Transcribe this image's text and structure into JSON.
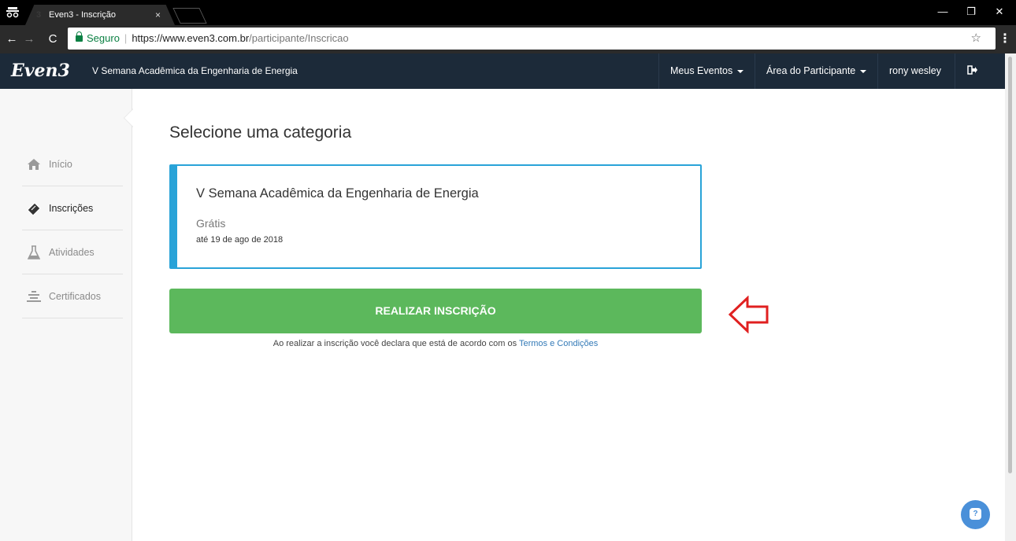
{
  "browser": {
    "tab_title": "Even3 - Inscrição",
    "tab_favicon": "3",
    "tab_close": "×",
    "secure_label": "Seguro",
    "url_host": "https://www.even3.com.br",
    "url_path": "/participante/Inscricao",
    "minimize": "—",
    "restore": "❐",
    "close": "✕"
  },
  "header": {
    "logo": "Even3",
    "event_title": "V Semana Acadêmica da Engenharia de Energia",
    "nav": {
      "meus_eventos": "Meus Eventos",
      "area_participante": "Área do Participante",
      "user_name": "rony wesley"
    }
  },
  "sidebar": {
    "items": [
      {
        "label": "Início",
        "icon": "home-icon"
      },
      {
        "label": "Inscrições",
        "icon": "ticket-icon"
      },
      {
        "label": "Atividades",
        "icon": "flask-icon"
      },
      {
        "label": "Certificados",
        "icon": "certificate-icon"
      }
    ]
  },
  "main": {
    "title": "Selecione uma categoria",
    "category": {
      "name": "V Semana Acadêmica da Engenharia de Energia",
      "price": "Grátis",
      "deadline": "até 19 de ago de 2018"
    },
    "submit_label": "REALIZAR INSCRIÇÃO",
    "terms_text": "Ao realizar a inscrição você declara que está de acordo com os ",
    "terms_link": "Termos e Condições"
  },
  "colors": {
    "header_bg": "#1c2a39",
    "accent_blue": "#29a3d8",
    "button_green": "#5cb85c",
    "annotation_red": "#e02020",
    "link_blue": "#337ab7"
  }
}
